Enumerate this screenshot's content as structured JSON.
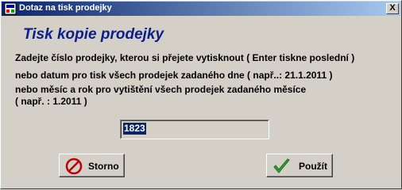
{
  "window": {
    "title": "Dotaz na tisk prodejky",
    "close_label": "X"
  },
  "dialog": {
    "heading": "Tisk kopie prodejky",
    "lines": [
      "Zadejte číslo prodejky, kterou si přejete vytisknout ( Enter tiskne poslední )",
      "nebo datum pro tisk všech prodejek zadaného dne ( např..: 21.1.2011 )",
      "nebo měsíc a rok pro vytištění všech prodejek zadaného měsíce",
      "( např. : 1.2011 )"
    ]
  },
  "input": {
    "value": "1823"
  },
  "buttons": {
    "cancel_label": "Storno",
    "apply_label": "Použít"
  },
  "colors": {
    "title_bar_start": "#0a246a",
    "title_bar_end": "#a6caf0",
    "heading": "#0a1e8c",
    "face": "#d4d0c8"
  },
  "icons": {
    "app": "app-icon",
    "close": "close-icon",
    "cancel": "no-sign-icon",
    "apply": "checkmark-icon"
  }
}
